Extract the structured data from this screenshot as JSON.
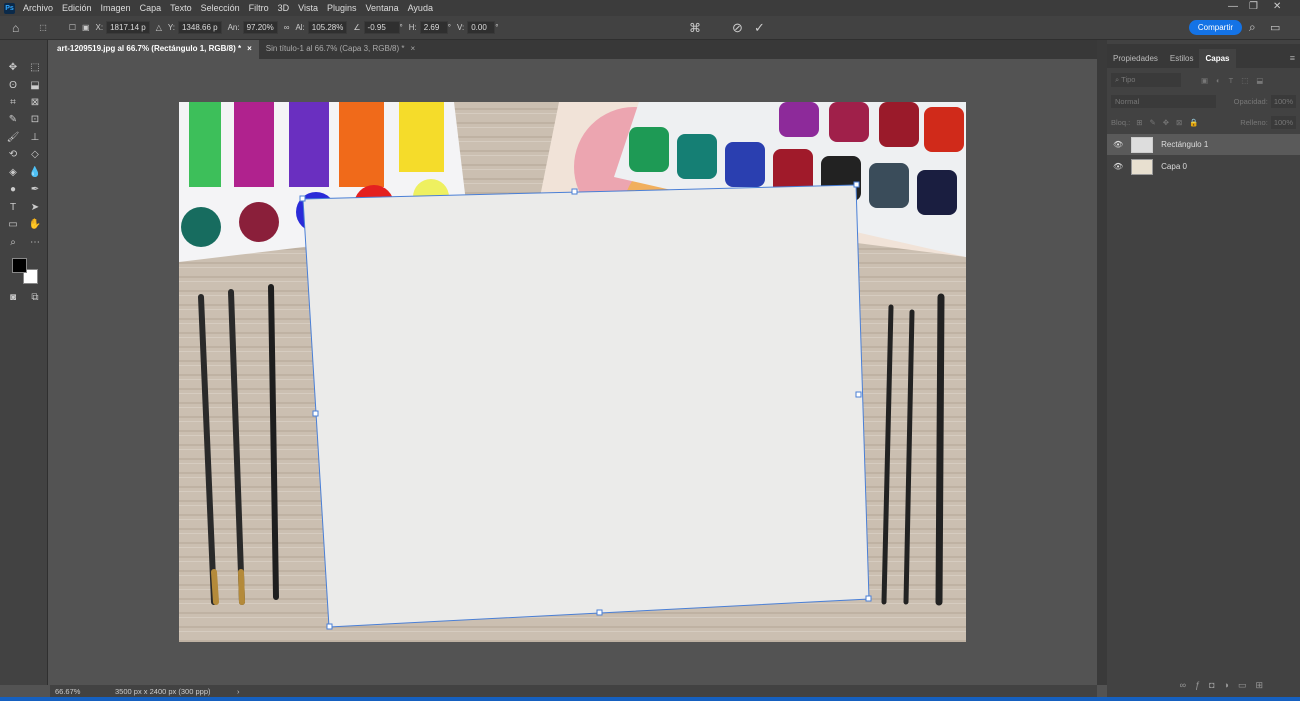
{
  "app": {
    "logo": "Ps"
  },
  "menu": [
    "Archivo",
    "Edición",
    "Imagen",
    "Capa",
    "Texto",
    "Selección",
    "Filtro",
    "3D",
    "Vista",
    "Plugins",
    "Ventana",
    "Ayuda"
  ],
  "options": {
    "x_label": "X:",
    "x": "1817.14 p",
    "y_label": "Y:",
    "y": "1348.66 p",
    "w_label": "An:",
    "w": "97.20%",
    "h_label": "Al:",
    "h": "105.28%",
    "angle": "-0.95",
    "angle_unit": "°",
    "hskew_label": "H:",
    "hskew": "2.69",
    "hskew_unit": "°",
    "vskew_label": "V:",
    "vskew": "0.00",
    "vskew_unit": "°",
    "share": "Compartir"
  },
  "tabs": [
    {
      "label": "art-1209519.jpg al 66.7% (Rectángulo 1, RGB/8) *",
      "close": "×"
    },
    {
      "label": "Sin título-1 al 66.7% (Capa 3, RGB/8) *",
      "close": "×"
    }
  ],
  "panel": {
    "tabs": [
      "Propiedades",
      "Estilos",
      "Capas"
    ],
    "search_placeholder": "Tipo",
    "blend": "Normal",
    "opacity_label": "Opacidad:",
    "opacity": "100%",
    "lock_label": "Bloq.:",
    "fill_label": "Relleno:",
    "fill": "100%",
    "layers": [
      {
        "name": "Rectángulo 1",
        "selected": true
      },
      {
        "name": "Capa 0",
        "selected": false
      }
    ]
  },
  "status": {
    "zoom": "66.67%",
    "doc": "3500 px x 2400 px (300 ppp)",
    "arrow": "›"
  },
  "colors": {
    "accent": "#1473e6",
    "selection": "#4a7fd6",
    "foreground": "#000000",
    "background": "#ffffff"
  }
}
